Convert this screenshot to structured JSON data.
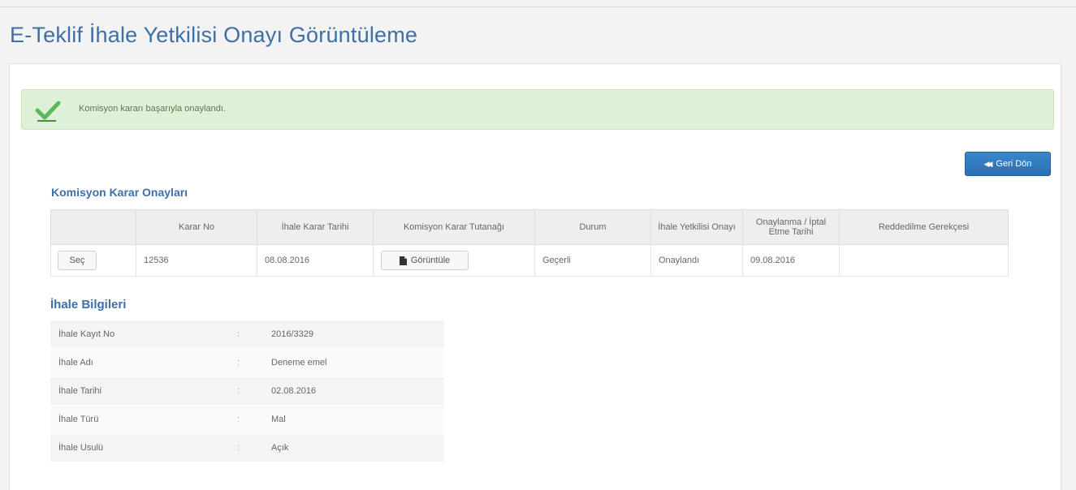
{
  "page": {
    "title": "E-Teklif İhale Yetkilisi Onayı Görüntüleme"
  },
  "alert": {
    "message": "Komisyon kararı başarıyla onaylandı.",
    "icon": "checkmark-icon",
    "color": "#dff0d8"
  },
  "actions": {
    "back_label": "Geri Dön",
    "back_icon": "double-chevron-left-icon"
  },
  "karar": {
    "title": "Komisyon Karar Onayları",
    "columns": [
      "",
      "Karar No",
      "İhale Karar Tarihi",
      "Komisyon Karar Tutanağı",
      "Durum",
      "İhale Yetkilisi Onayı",
      "Onaylanma / İptal Etme Tarihi",
      "Reddedilme Gerekçesi"
    ],
    "rows": [
      {
        "select_label": "Seç",
        "karar_no": "12536",
        "ihale_karar_tarihi": "08.08.2016",
        "view_label": "Görüntüle",
        "durum": "Geçerli",
        "onay": "Onaylandı",
        "onay_tarihi": "09.08.2016",
        "red_gerekce": ""
      }
    ]
  },
  "bilgi": {
    "title": "İhale Bilgileri",
    "rows": [
      {
        "label": "İhale Kayıt No",
        "sep": ":",
        "value": "2016/3329"
      },
      {
        "label": "İhale Adı",
        "sep": ":",
        "value": "Deneme emel"
      },
      {
        "label": "İhale Tarihi",
        "sep": ":",
        "value": "02.08.2016"
      },
      {
        "label": "İhale Türü",
        "sep": ":",
        "value": "Mal"
      },
      {
        "label": "İhale Usulü",
        "sep": ":",
        "value": "Açık"
      }
    ]
  },
  "colors": {
    "title": "#3d6fa8",
    "primary_button": "#2c6fb1",
    "success": "#5cb85c"
  }
}
